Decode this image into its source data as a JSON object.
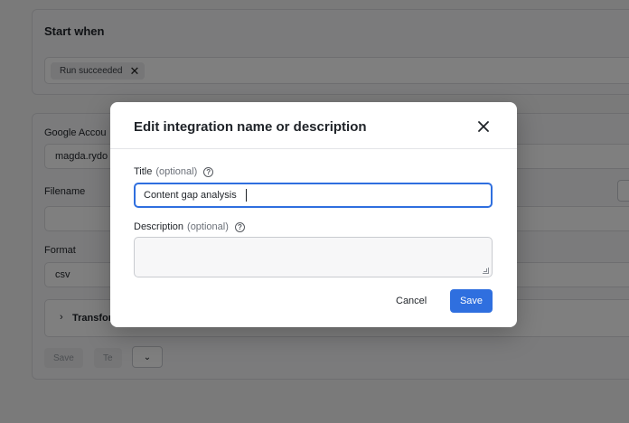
{
  "background": {
    "start_section": {
      "title": "Start when",
      "chip_label": "Run succeeded"
    },
    "account": {
      "label": "Google Accou",
      "value": "magda.rydo"
    },
    "filename": {
      "label": "Filename",
      "value": ""
    },
    "format": {
      "label": "Format",
      "value": "csv"
    },
    "transform": {
      "label": "Transfor"
    },
    "buttons": {
      "save": "Save",
      "test": "Te"
    }
  },
  "modal": {
    "title": "Edit integration name or description",
    "title_field": {
      "label": "Title",
      "optional": "(optional)",
      "value": "Content gap analysis"
    },
    "description_field": {
      "label": "Description",
      "optional": "(optional)",
      "value": ""
    },
    "cancel_label": "Cancel",
    "save_label": "Save"
  },
  "colors": {
    "accent": "#2f6fdf",
    "overlay": "rgba(0,0,0,0.5)"
  }
}
